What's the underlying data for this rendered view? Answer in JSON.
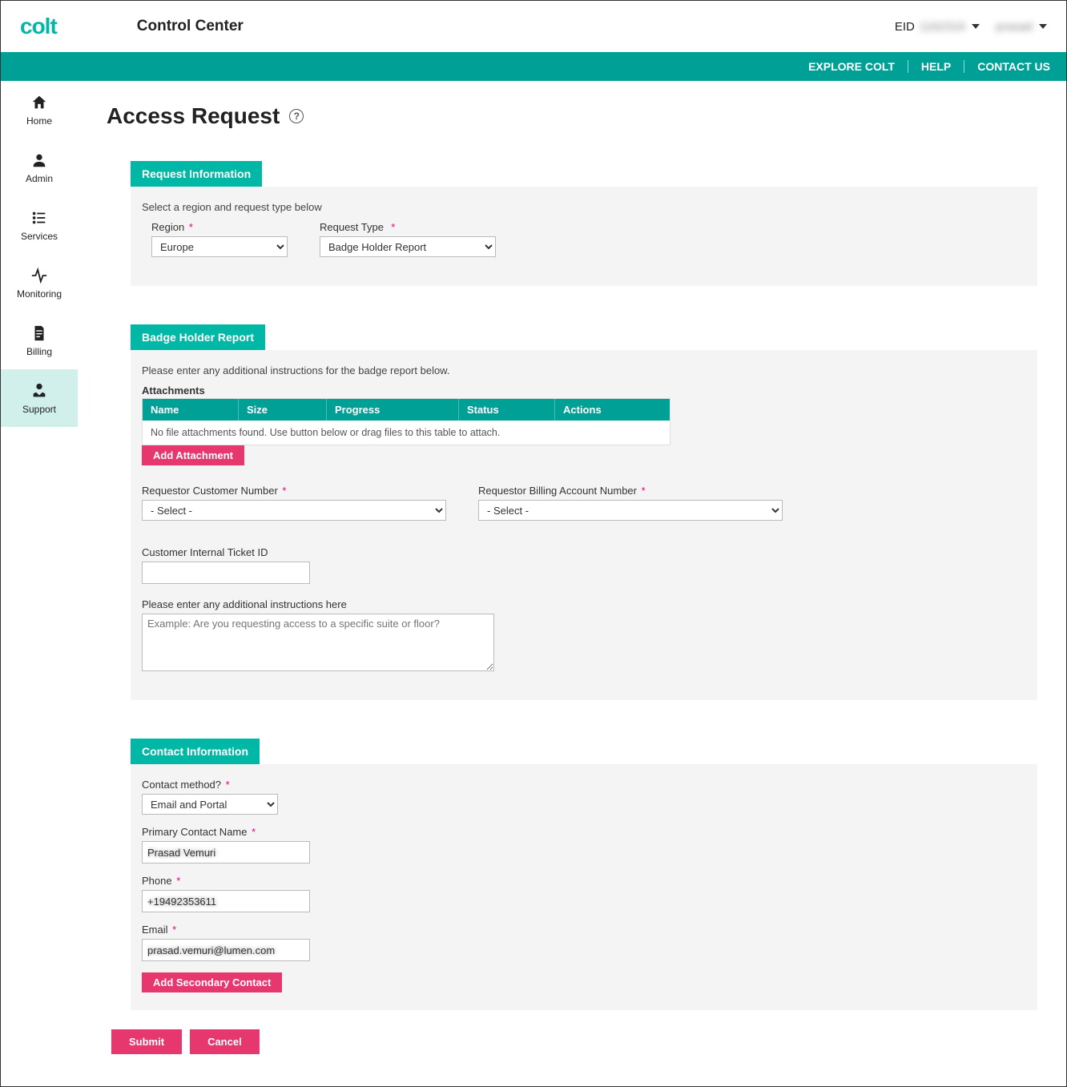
{
  "header": {
    "app_title": "Control Center",
    "eid_label": "EID",
    "eid_value": "1162316",
    "user_name": "prasad"
  },
  "navbar": {
    "explore": "EXPLORE COLT",
    "help": "HELP",
    "contact": "CONTACT US"
  },
  "sidebar": {
    "items": [
      {
        "label": "Home",
        "icon": "home-icon"
      },
      {
        "label": "Admin",
        "icon": "user-icon"
      },
      {
        "label": "Services",
        "icon": "list-icon"
      },
      {
        "label": "Monitoring",
        "icon": "activity-icon"
      },
      {
        "label": "Billing",
        "icon": "billing-icon"
      },
      {
        "label": "Support",
        "icon": "support-icon"
      }
    ]
  },
  "page": {
    "title": "Access Request"
  },
  "request_info": {
    "tab": "Request Information",
    "hint": "Select a region and request type below",
    "region_label": "Region",
    "region_value": "Europe",
    "request_type_label": "Request Type",
    "request_type_value": "Badge Holder Report"
  },
  "badge": {
    "tab": "Badge Holder Report",
    "hint": "Please enter any additional instructions for the badge report below.",
    "attachments_label": "Attachments",
    "cols": {
      "name": "Name",
      "size": "Size",
      "progress": "Progress",
      "status": "Status",
      "actions": "Actions"
    },
    "empty": "No file attachments found. Use button below or drag files to this table to attach.",
    "add_attachment": "Add Attachment",
    "req_cust_num_label": "Requestor Customer Number",
    "req_cust_num_value": "- Select -",
    "req_billing_label": "Requestor Billing Account Number",
    "req_billing_value": "- Select -",
    "internal_ticket_label": "Customer Internal Ticket ID",
    "internal_ticket_value": "",
    "additional_label": "Please enter any additional instructions here",
    "additional_placeholder": "Example: Are you requesting access to a specific suite or floor?"
  },
  "contact": {
    "tab": "Contact Information",
    "method_label": "Contact method?",
    "method_value": "Email and Portal",
    "primary_name_label": "Primary Contact Name",
    "primary_name_value": "Prasad Vemuri",
    "phone_label": "Phone",
    "phone_value": "+19492353611",
    "email_label": "Email",
    "email_value": "prasad.vemuri@lumen.com",
    "add_secondary": "Add Secondary Contact"
  },
  "footer": {
    "submit": "Submit",
    "cancel": "Cancel"
  }
}
